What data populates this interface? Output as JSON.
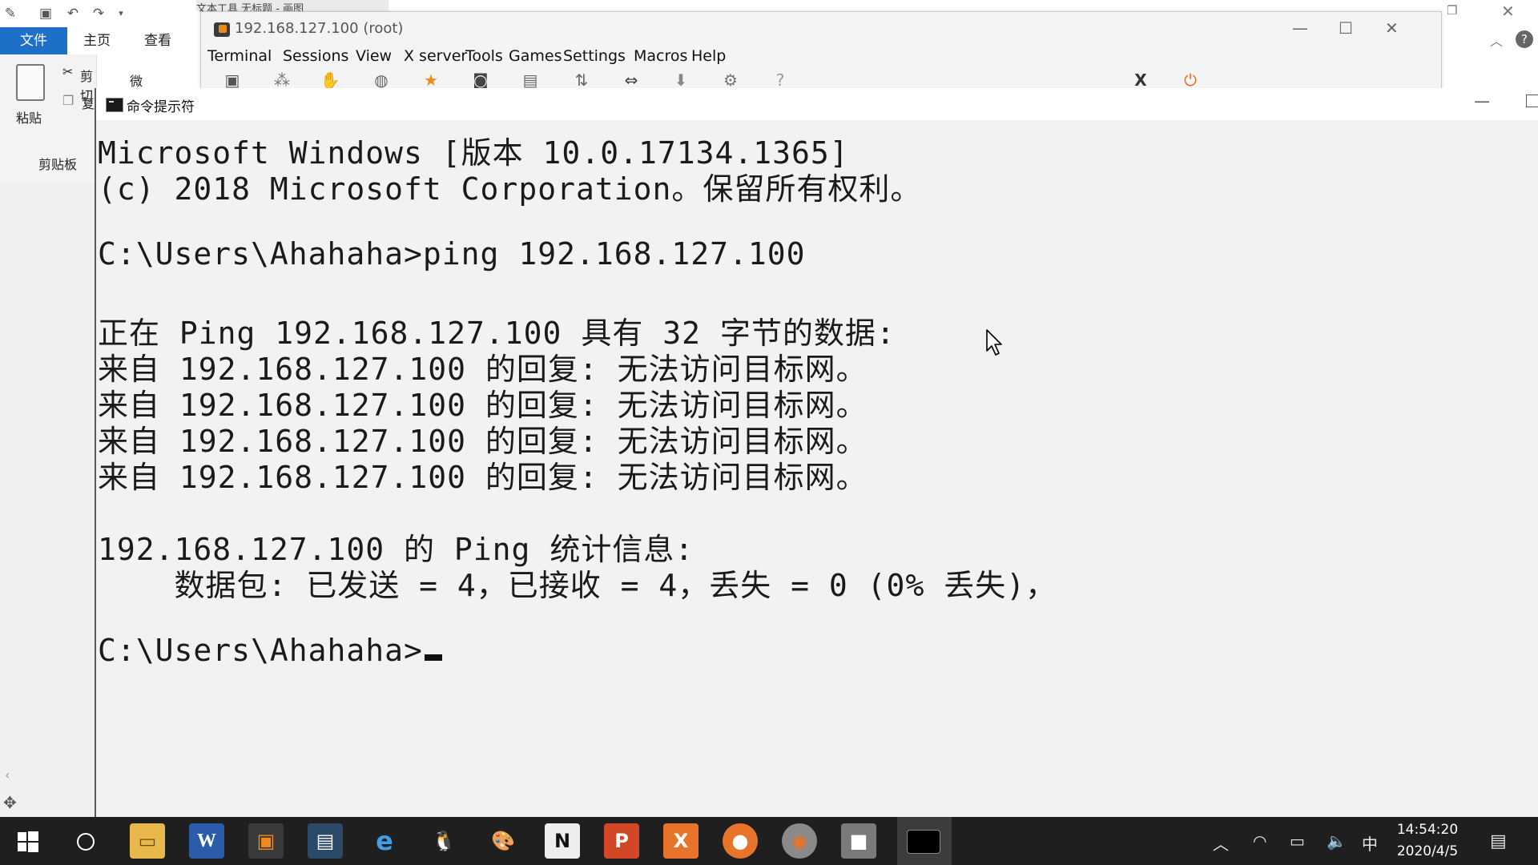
{
  "background_app": {
    "tab_file": "文件",
    "tab_home": "主页",
    "tab_view": "查看",
    "partial_tabs": "文本工具  无标题 - 画图",
    "cut_label": "剪切",
    "copy_label": "复",
    "font_name": "微软雅黑",
    "paste_label": "粘贴",
    "clipboard_label": "剪贴板"
  },
  "mobaxterm": {
    "title": "192.168.127.100 (root)",
    "menu": [
      "Terminal",
      "Sessions",
      "View",
      "X server",
      "Tools",
      "Games",
      "Settings",
      "Macros",
      "Help"
    ]
  },
  "cmd": {
    "title": "命令提示符",
    "lines": [
      "Microsoft Windows [版本 10.0.17134.1365]",
      "(c) 2018 Microsoft Corporation。保留所有权利。",
      "",
      "C:\\Users\\Ahahaha>ping 192.168.127.100",
      "",
      "正在 Ping 192.168.127.100 具有 32 字节的数据:",
      "来自 192.168.127.100 的回复: 无法访问目标网。",
      "来自 192.168.127.100 的回复: 无法访问目标网。",
      "来自 192.168.127.100 的回复: 无法访问目标网。",
      "来自 192.168.127.100 的回复: 无法访问目标网。",
      "",
      "192.168.127.100 的 Ping 统计信息:",
      "    数据包: 已发送 = 4，已接收 = 4，丢失 = 0 (0% 丢失)，",
      "",
      "C:\\Users\\Ahahaha>"
    ]
  },
  "taskbar": {
    "ime": "中",
    "time": "14:54:20",
    "date": "2020/4/5",
    "apps": [
      "file-explorer",
      "word",
      "mobaxterm",
      "remote-desktop",
      "internet-explorer",
      "qq",
      "paint",
      "onenote",
      "powerpoint",
      "xmind",
      "firefox",
      "chrome",
      "zoom",
      "cmd"
    ]
  }
}
